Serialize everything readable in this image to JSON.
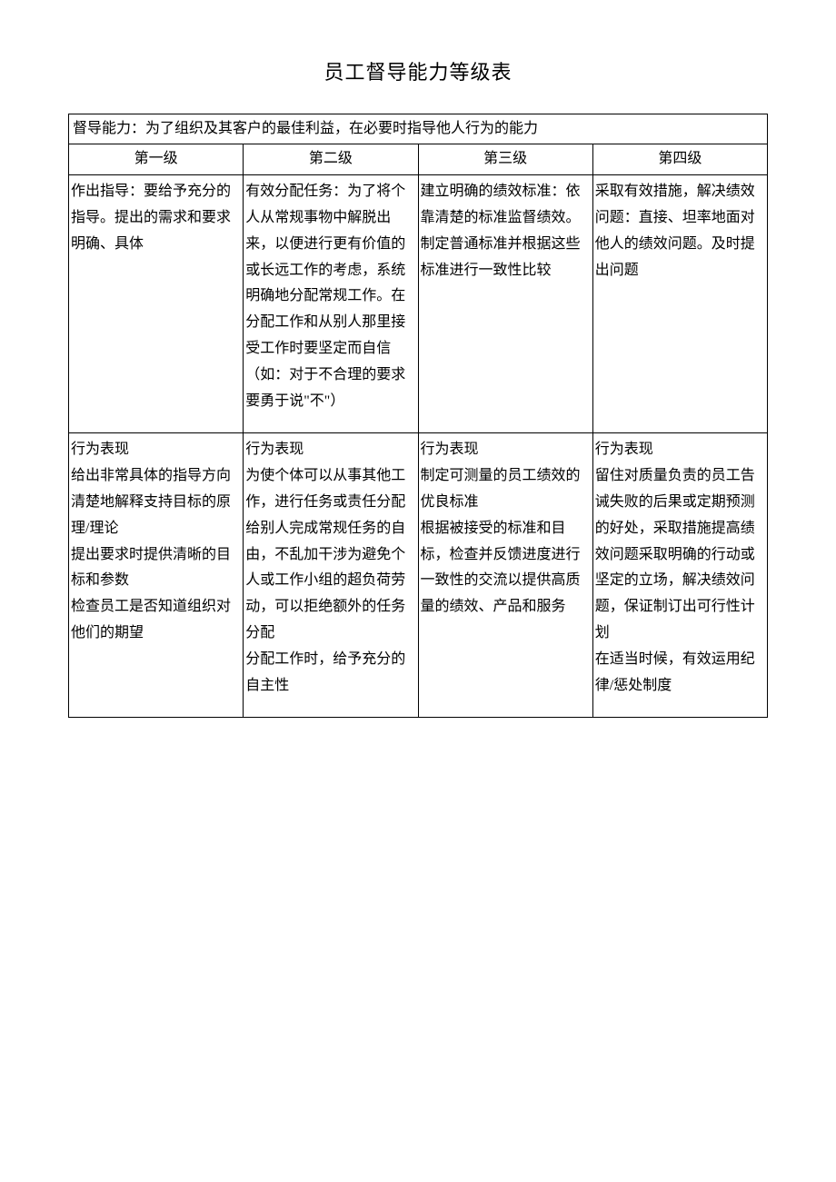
{
  "title": "员工督导能力等级表",
  "description": "督导能力：为了组织及其客户的最佳利益，在必要时指导他人行为的能力",
  "headers": {
    "level1": "第一级",
    "level2": "第二级",
    "level3": "第三级",
    "level4": "第四级"
  },
  "row1": {
    "level1": "作出指导：要给予充分的指导。提出的需求和要求明确、具体",
    "level2": "有效分配任务：为了将个人从常规事物中解脱出来，以便进行更有价值的或长远工作的考虑，系统明确地分配常规工作。在分配工作和从别人那里接受工作时要坚定而自信（如：对于不合理的要求要勇于说\"不\"）",
    "level3": "建立明确的绩效标准：依靠清楚的标准监督绩效。制定普通标准并根据这些标准进行一致性比较",
    "level4": "采取有效措施，解决绩效问题：直接、坦率地面对他人的绩效问题。及时提出问题"
  },
  "row2": {
    "level1": "行为表现\n给出非常具体的指导方向\n清楚地解释支持目标的原理/理论\n提出要求时提供清晰的目标和参数\n检查员工是否知道组织对他们的期望",
    "level2": "行为表现\n为使个体可以从事其他工作，进行任务或责任分配\n给别人完成常规任务的自由，不乱加干涉为避免个人或工作小组的超负荷劳动，可以拒绝额外的任务分配\n分配工作时，给予充分的自主性",
    "level3": "行为表现\n制定可测量的员工绩效的优良标准\n根据被接受的标准和目标，检查并反馈进度进行一致性的交流以提供高质量的绩效、产品和服务",
    "level4": "行为表现\n留住对质量负责的员工告诫失败的后果或定期预测的好处，采取措施提高绩效问题采取明确的行动或坚定的立场，解决绩效问题，保证制订出可行性计划\n在适当时候，有效运用纪律/惩处制度"
  }
}
